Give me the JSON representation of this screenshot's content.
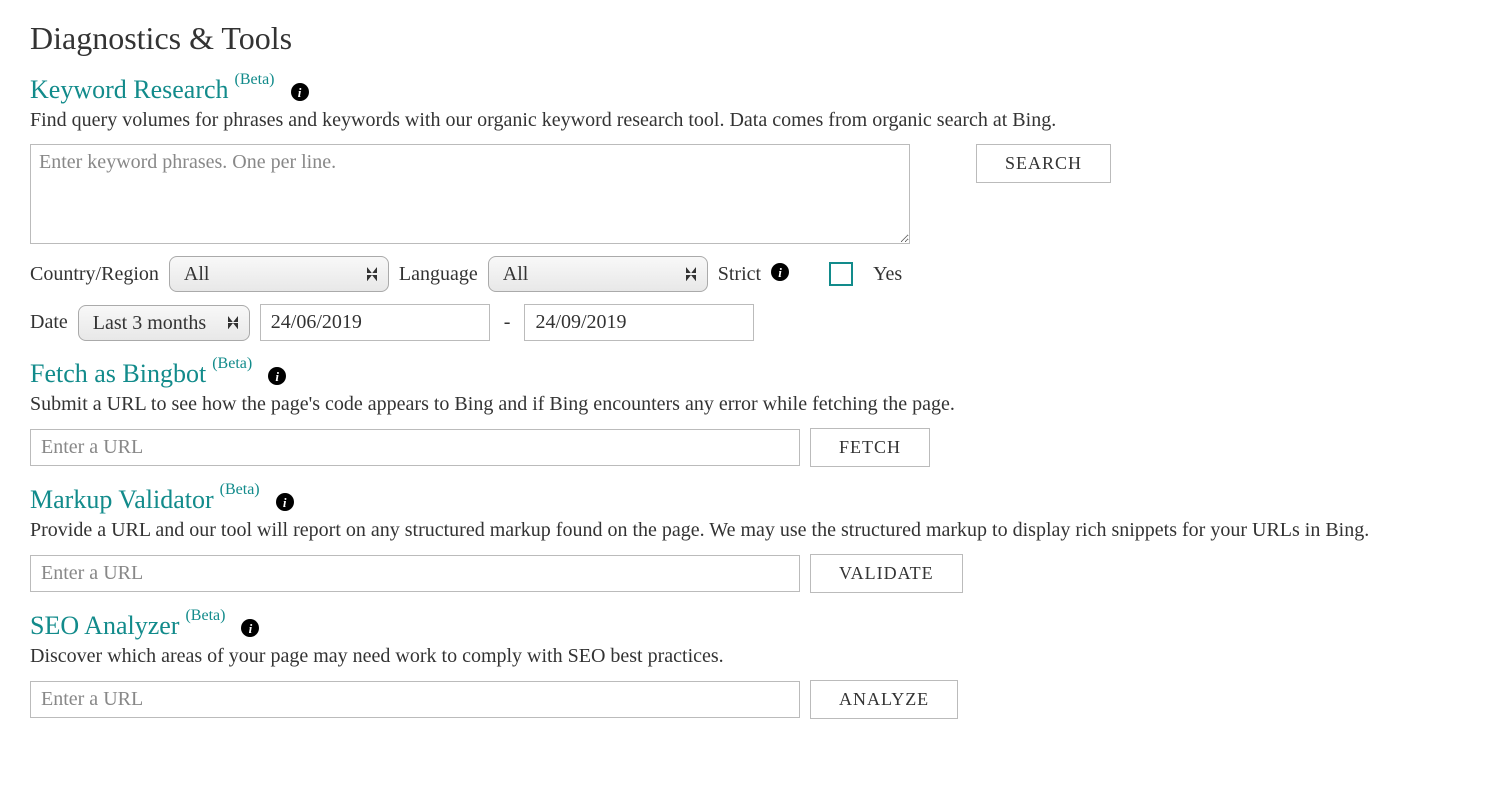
{
  "page": {
    "title": "Diagnostics & Tools"
  },
  "common": {
    "beta": "(Beta)"
  },
  "keyword_research": {
    "title": "Keyword Research",
    "desc": "Find query volumes for phrases and keywords with our organic keyword research tool. Data comes from organic search at Bing.",
    "textarea_placeholder": "Enter keyword phrases. One per line.",
    "search_btn": "SEARCH",
    "country_label": "Country/Region",
    "country_value": "All",
    "language_label": "Language",
    "language_value": "All",
    "strict_label": "Strict",
    "strict_yes": "Yes",
    "date_label": "Date",
    "date_range_value": "Last 3 months",
    "date_from": "24/06/2019",
    "date_to": "24/09/2019",
    "dash": "-"
  },
  "fetch_bingbot": {
    "title": "Fetch as Bingbot",
    "desc": "Submit a URL to see how the page's code appears to Bing and if Bing encounters any error while fetching the page.",
    "url_placeholder": "Enter a URL",
    "btn": "FETCH"
  },
  "markup_validator": {
    "title": "Markup Validator",
    "desc": "Provide a URL and our tool will report on any structured markup found on the page. We may use the structured markup to display rich snippets for your URLs in Bing.",
    "url_placeholder": "Enter a URL",
    "btn": "VALIDATE"
  },
  "seo_analyzer": {
    "title": "SEO Analyzer",
    "desc": "Discover which areas of your page may need work to comply with SEO best practices.",
    "url_placeholder": "Enter a URL",
    "btn": "ANALYZE"
  }
}
